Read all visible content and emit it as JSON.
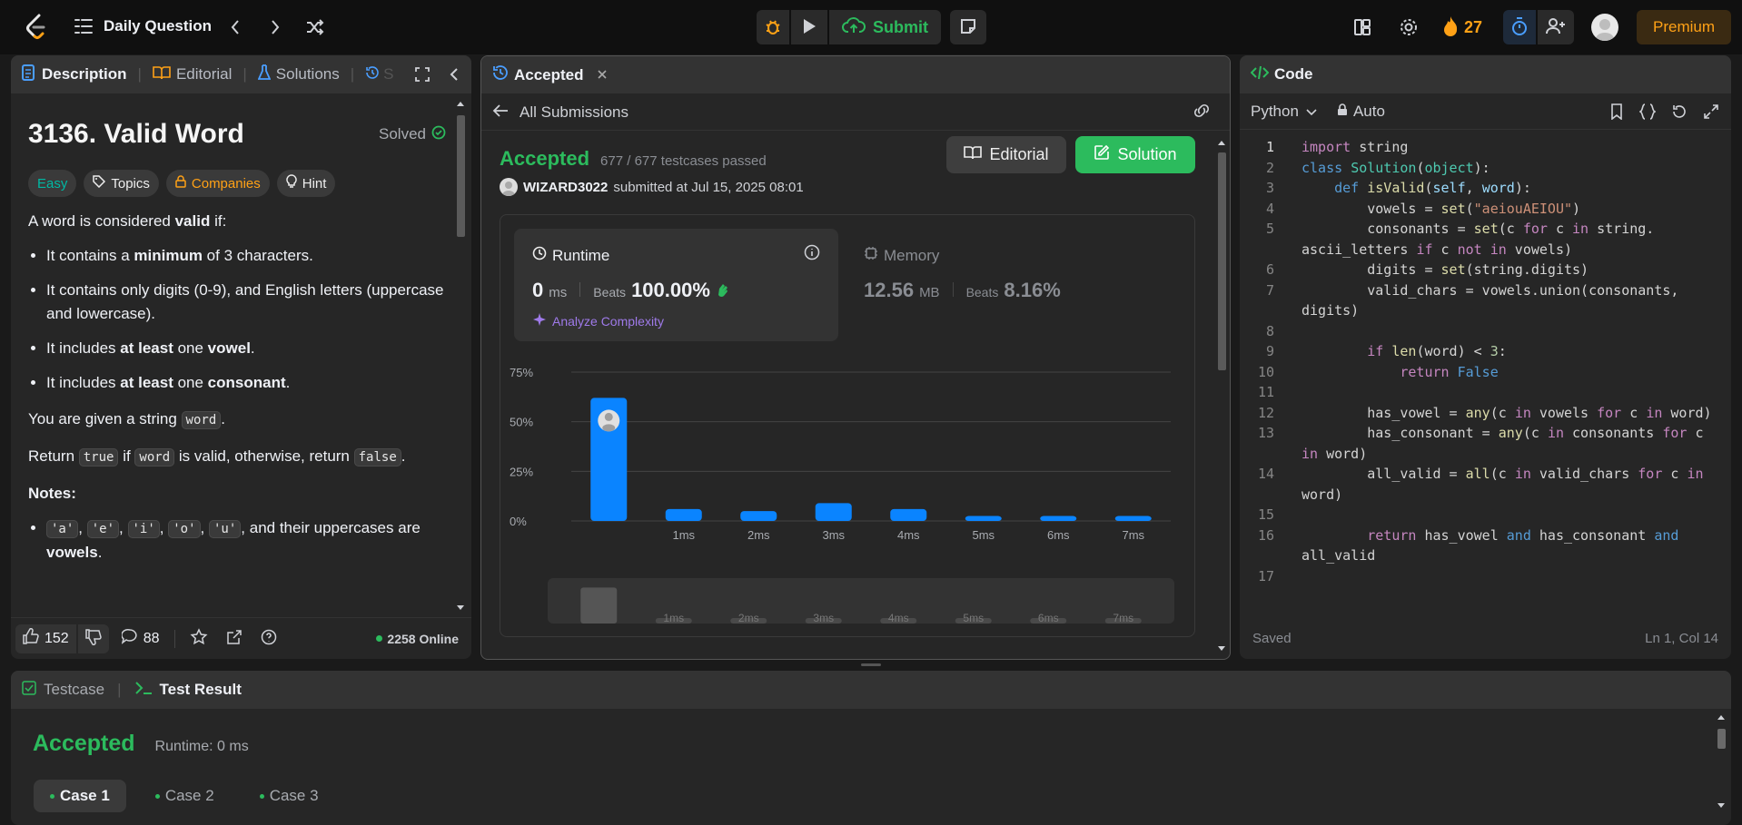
{
  "topbar": {
    "title": "Daily Question",
    "submit_label": "Submit",
    "streak_count": "27",
    "premium_label": "Premium"
  },
  "left_panel": {
    "tabs": [
      "Description",
      "Editorial",
      "Solutions",
      "S"
    ],
    "problem_title": "3136. Valid Word",
    "solved_label": "Solved",
    "tags": {
      "difficulty": "Easy",
      "topics": "Topics",
      "companies": "Companies",
      "hint": "Hint"
    },
    "desc": {
      "p1_pre": "A word is considered ",
      "p1_b": "valid",
      "p1_post": " if:",
      "li1_pre": "It contains a ",
      "li1_b": "minimum",
      "li1_post": " of 3 characters.",
      "li2": "It contains only digits (0-9), and English letters (uppercase and lowercase).",
      "li3_pre": "It includes ",
      "li3_b": "at least",
      "li3_mid": " one ",
      "li3_b2": "vowel",
      "li3_post": ".",
      "li4_pre": "It includes ",
      "li4_b": "at least",
      "li4_mid": " one ",
      "li4_b2": "consonant",
      "li4_post": ".",
      "p2_pre": "You are given a string ",
      "p2_code": "word",
      "p2_post": ".",
      "p3_a": "Return ",
      "p3_code1": "true",
      "p3_b": " if ",
      "p3_code2": "word",
      "p3_c": " is valid, otherwise, return ",
      "p3_code3": "false",
      "p3_d": ".",
      "notes": "Notes:",
      "n1_codes": [
        "'a'",
        "'e'",
        "'i'",
        "'o'",
        "'u'"
      ],
      "n1_post": ", and their uppercases are ",
      "n1_b": "vowels",
      "n1_end": "."
    },
    "footer": {
      "likes": "152",
      "comments": "88",
      "online": "2258 Online"
    }
  },
  "middle_panel": {
    "tab_label": "Accepted",
    "back_label": "All Submissions",
    "status": "Accepted",
    "testcases": "677 / 677 testcases passed",
    "user": "WIZARD3022",
    "submitted": "submitted at Jul 15, 2025 08:01",
    "editorial_btn": "Editorial",
    "solution_btn": "Solution",
    "runtime": {
      "label": "Runtime",
      "value": "0",
      "unit": "ms",
      "beats_label": "Beats",
      "beats": "100.00%",
      "analyze": "Analyze Complexity"
    },
    "memory": {
      "label": "Memory",
      "value": "12.56",
      "unit": "MB",
      "beats_label": "Beats",
      "beats": "8.16%"
    }
  },
  "chart_data": {
    "type": "bar",
    "categories": [
      "0ms",
      "1ms",
      "2ms",
      "3ms",
      "4ms",
      "5ms",
      "6ms",
      "7ms"
    ],
    "category_labels": [
      "",
      "1ms",
      "2ms",
      "3ms",
      "4ms",
      "5ms",
      "6ms",
      "7ms"
    ],
    "values": [
      62,
      6,
      5,
      9,
      6,
      2.5,
      2.5,
      2.5
    ],
    "highlight_index": 0,
    "ylim": [
      0,
      75
    ],
    "yticks": [
      "0%",
      "25%",
      "50%",
      "75%"
    ],
    "ytick_values": [
      0,
      25,
      50,
      75
    ],
    "bar_color": "#0a84ff",
    "grid": true,
    "minimap_labels": [
      "1ms",
      "2ms",
      "3ms",
      "4ms",
      "5ms",
      "6ms",
      "7ms"
    ]
  },
  "right_panel": {
    "title": "Code",
    "language": "Python",
    "auto_label": "Auto",
    "saved": "Saved",
    "cursor": "Ln 1, Col 14"
  },
  "bottom_panel": {
    "tabs": [
      "Testcase",
      "Test Result"
    ],
    "status": "Accepted",
    "runtime": "Runtime: 0 ms",
    "cases": [
      "Case 1",
      "Case 2",
      "Case 3"
    ]
  }
}
